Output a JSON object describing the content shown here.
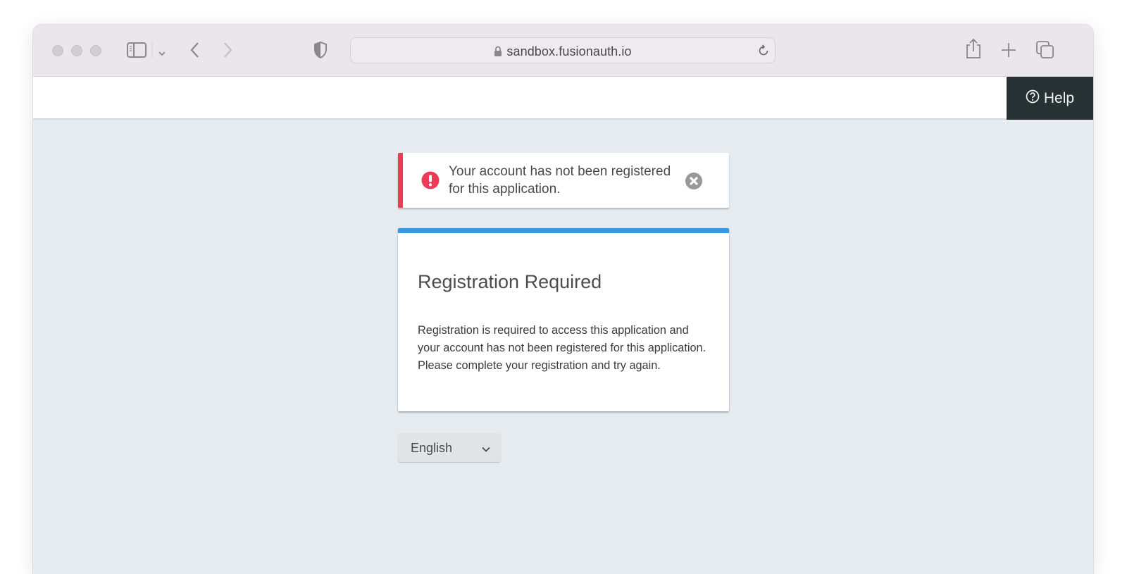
{
  "browser": {
    "address": "sandbox.fusionauth.io",
    "icons": {
      "traffic_lights": [
        "close",
        "minimize",
        "zoom"
      ],
      "sidebar": "sidebar-icon",
      "sidebar_menu": "chevron-down-icon",
      "back": "chevron-left-icon",
      "forward": "chevron-right-icon",
      "privacy": "shield-icon",
      "lock": "lock-icon",
      "reload": "reload-icon",
      "share": "share-icon",
      "new_tab": "plus-icon",
      "tabs": "tabs-overview-icon"
    }
  },
  "header": {
    "help_label": "Help",
    "help_icon": "question-circle-icon"
  },
  "alert": {
    "type": "error",
    "message": "Your account has not been registered for this application.",
    "icon": "exclamation-circle-icon",
    "close_icon": "close-circle-icon",
    "accent_color": "#ed3a57"
  },
  "panel": {
    "title": "Registration Required",
    "body": "Registration is required to access this application and your account has not been registered for this application. Please complete your registration and try again.",
    "accent_color": "#3a97dc"
  },
  "locale": {
    "selected": "English"
  }
}
